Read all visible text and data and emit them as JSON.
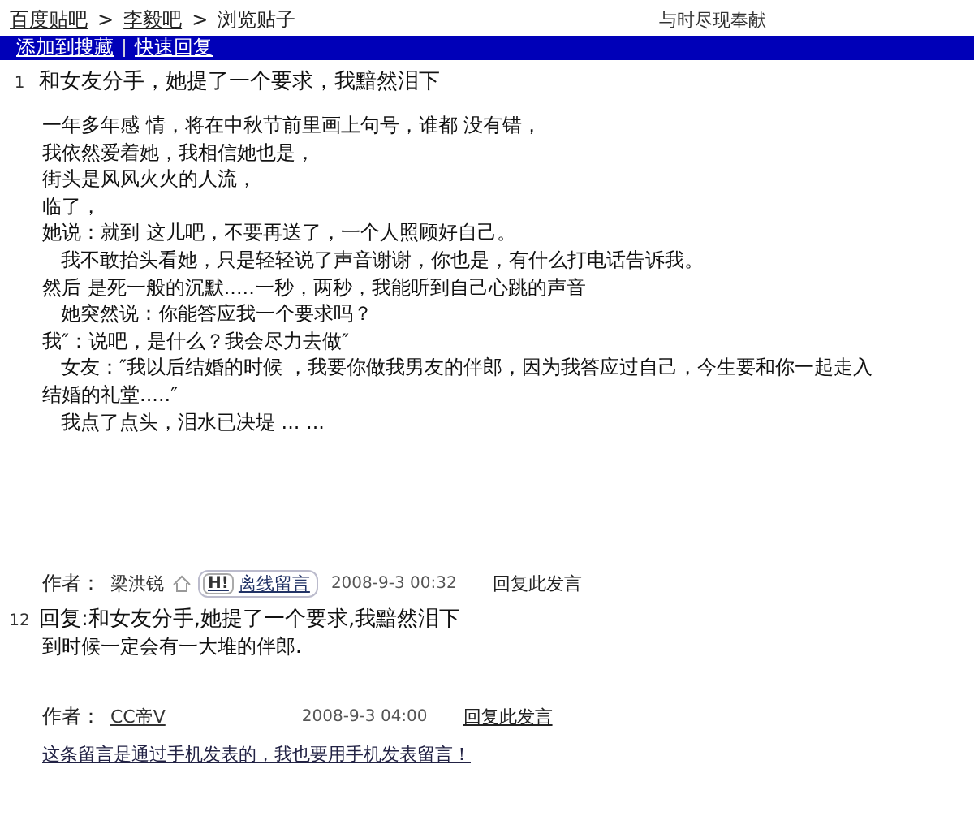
{
  "breadcrumb": [
    {
      "label": "百度贴吧",
      "link": true
    },
    {
      "label": "李毅吧",
      "link": true
    },
    {
      "label": "浏览贴子",
      "link": false
    }
  ],
  "slogan": "与时尽现奉献",
  "separator": ">",
  "toolbar": [
    "添加到搜藏",
    "快速回复"
  ],
  "posts": [
    {
      "number": "1",
      "title": "和女友分手，她提了一个要求，我黯然泪下",
      "body": [
        "一年多年感 情，将在中秋节前里画上句号，谁都 没有错，",
        "我依然爱着她，我相信她也是，",
        "街头是风风火火的人流，",
        "临了，",
        "她说：就到 这儿吧，不要再送了，一个人照顾好自己。",
        "   我不敢抬头看她，只是轻轻说了声音谢谢，你也是，有什么打电话告诉我。",
        "然后 是死一般的沉默.....一秒，两秒，我能听到自己心跳的声音",
        "   她突然说：你能答应我一个要求吗？",
        "我″：说吧，是什么？我会尽力去做″",
        "   女友：″我以后结婚的时候 ，我要你做我男友的伴郎，因为我答应过自己，今生要和你一起走入",
        "结婚的礼堂.....″",
        "   我点了点头，泪水已决堤 ... ..."
      ],
      "author_label": "作者：",
      "author": "梁洪锐",
      "author_link": false,
      "badge": "H!",
      "offline_message": "离线留言",
      "date": "2008-9-3 00:32",
      "reply": "回复此发言",
      "reply_link": false
    },
    {
      "number": "12",
      "title": "回复:和女友分手,她提了一个要求,我黯然泪下",
      "body": [
        "到时候一定会有一大堆的伴郎."
      ],
      "author_label": "作者：",
      "author": "CC帝V",
      "author_link": true,
      "date": "2008-9-3 04:00",
      "reply": "回复此发言",
      "reply_link": true
    }
  ],
  "mobile_link": "这条留言是通过手机发表的，我也要用手机发表留言！"
}
